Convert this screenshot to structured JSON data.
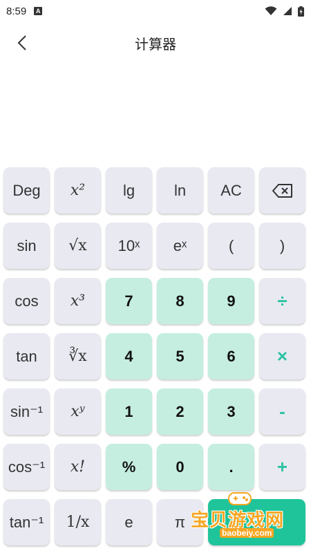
{
  "status_bar": {
    "time": "8:59",
    "a_badge": "A"
  },
  "header": {
    "title": "计算器"
  },
  "keys": [
    [
      {
        "label": "Deg"
      },
      {
        "label": "x²"
      },
      {
        "label": "lg"
      },
      {
        "label": "ln"
      },
      {
        "label": "AC"
      },
      {
        "icon": "backspace-icon"
      }
    ],
    [
      {
        "label": "sin"
      },
      {
        "label": "√x"
      },
      {
        "label": "10ˣ"
      },
      {
        "label": "eˣ"
      },
      {
        "label": "("
      },
      {
        "label": ")"
      }
    ],
    [
      {
        "label": "cos"
      },
      {
        "label": "x³"
      },
      {
        "label": "7"
      },
      {
        "label": "8"
      },
      {
        "label": "9"
      },
      {
        "label": "÷"
      }
    ],
    [
      {
        "label": "tan"
      },
      {
        "label": "∛x"
      },
      {
        "label": "4"
      },
      {
        "label": "5"
      },
      {
        "label": "6"
      },
      {
        "label": "×"
      }
    ],
    [
      {
        "label": "sin⁻¹"
      },
      {
        "label": "xʸ"
      },
      {
        "label": "1"
      },
      {
        "label": "2"
      },
      {
        "label": "3"
      },
      {
        "label": "-"
      }
    ],
    [
      {
        "label": "cos⁻¹"
      },
      {
        "label": "x!"
      },
      {
        "label": "%"
      },
      {
        "label": "0"
      },
      {
        "label": "."
      },
      {
        "label": "+"
      }
    ],
    [
      {
        "label": "tan⁻¹"
      },
      {
        "label": "1/x"
      },
      {
        "label": "e"
      },
      {
        "label": "π"
      },
      {
        "label": "="
      }
    ]
  ],
  "watermark": {
    "text": "宝贝游戏网",
    "url": "baobeiy.com"
  },
  "colors": {
    "key_bg": "#e8e9f1",
    "number_key_bg": "#c5eee0",
    "operator_color": "#2dc3a3",
    "equals_bg": "#1fc49a"
  }
}
